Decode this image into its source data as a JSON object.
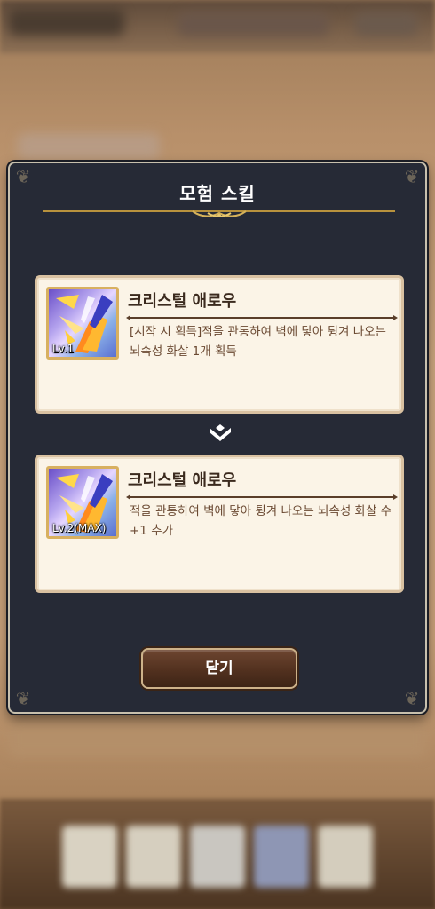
{
  "modal": {
    "title": "모험 스킬",
    "close_label": "닫기"
  },
  "skills": [
    {
      "name": "크리스털 애로우",
      "level": "Lv.1",
      "description": "[시작 시 획득]적을 관통하여 벽에 닿아 튕겨 나오는 뇌속성 화살 1개 획득",
      "icon": "crystal-arrow-icon"
    },
    {
      "name": "크리스털 애로우",
      "level": "Lv.2(MAX)",
      "description": "적을 관통하여 벽에 닿아 튕겨 나오는 뇌속성 화살 수 +1 추가",
      "icon": "crystal-arrow-icon"
    }
  ],
  "colors": {
    "modal_bg": "#262a36",
    "panel_bg": "#fbf4e7",
    "gold_accent": "#c9a24a",
    "title_text": "#ffffff",
    "name_text": "#3b2a1e",
    "desc_text": "#6b4a33",
    "button_bg": "#52311f"
  }
}
